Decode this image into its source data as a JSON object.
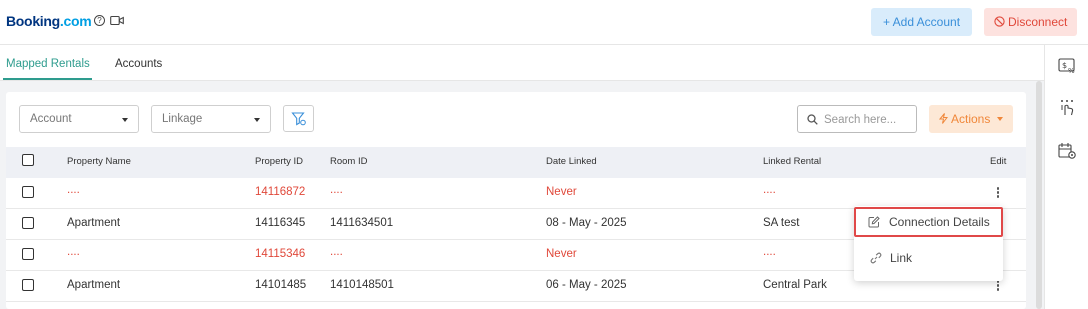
{
  "header": {
    "brand_main": "Booking",
    "brand_suffix": ".com",
    "help_glyph": "?",
    "add_account_label": "+ Add Account",
    "disconnect_label": "Disconnect"
  },
  "tabs": [
    {
      "label": "Mapped Rentals",
      "active": true
    },
    {
      "label": "Accounts",
      "active": false
    }
  ],
  "filters": {
    "account_label": "Account",
    "linkage_label": "Linkage",
    "search_placeholder": "Search here...",
    "actions_label": "Actions"
  },
  "table": {
    "columns": [
      "Property Name",
      "Property ID",
      "Room ID",
      "Date Linked",
      "Linked Rental",
      "Edit"
    ],
    "rows": [
      {
        "name": "....",
        "property_id": "14116872",
        "room_id": "....",
        "date": "Never",
        "linked": "....",
        "error": true
      },
      {
        "name": "Apartment",
        "property_id": "14116345",
        "room_id": "1411634501",
        "date": "08 - May - 2025",
        "linked": "SA test",
        "error": false
      },
      {
        "name": "....",
        "property_id": "14115346",
        "room_id": "....",
        "date": "Never",
        "linked": "....",
        "error": true
      },
      {
        "name": "Apartment",
        "property_id": "14101485",
        "room_id": "1410148501",
        "date": "06 - May - 2025",
        "linked": "Central Park",
        "error": false
      }
    ]
  },
  "menu": {
    "items": [
      {
        "label": "Connection Details",
        "icon": "edit-icon"
      },
      {
        "label": "Link",
        "icon": "link-icon"
      }
    ]
  },
  "colors": {
    "accent": "#2e9c8e",
    "error": "#e0483a",
    "brand": "#003580"
  }
}
